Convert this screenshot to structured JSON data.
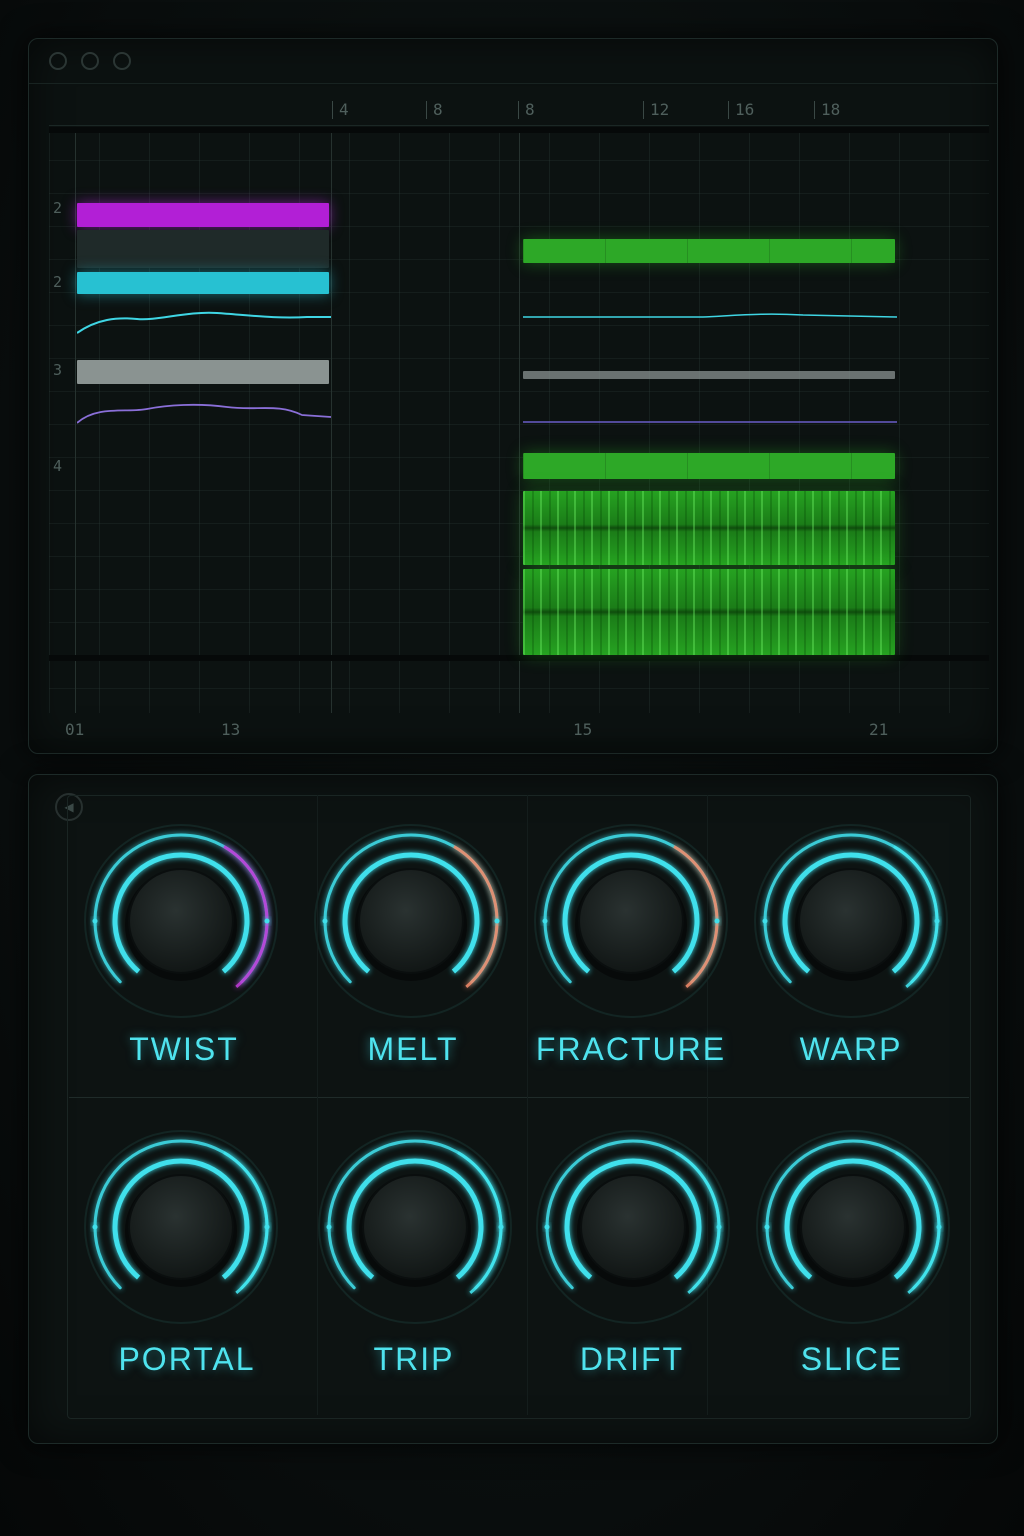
{
  "arrangement": {
    "ruler_top": [
      "4",
      "8",
      "8",
      "12",
      "16",
      "18"
    ],
    "track_numbers": [
      "2",
      "2",
      "3",
      "4"
    ],
    "ruler_bottom": [
      "01",
      "13",
      "15",
      "21"
    ]
  },
  "effects": {
    "knobs": [
      {
        "label": "TWIST",
        "value": 0.5,
        "accent": "#c03ad8"
      },
      {
        "label": "MELT",
        "value": 0.5,
        "accent": "#f08a6a"
      },
      {
        "label": "FRACTURE",
        "value": 0.5,
        "accent": "#f08a6a"
      },
      {
        "label": "WARP",
        "value": 0.5,
        "accent": "#42e6f0"
      },
      {
        "label": "PORTAL",
        "value": 0.5,
        "accent": "#42e6f0"
      },
      {
        "label": "TRIP",
        "value": 0.5,
        "accent": "#42e6f0"
      },
      {
        "label": "DRIFT",
        "value": 0.5,
        "accent": "#42e6f0"
      },
      {
        "label": "SLICE",
        "value": 0.5,
        "accent": "#42e6f0"
      }
    ]
  },
  "colors": {
    "knob_glow": "#3fe0ec",
    "clip_purple": "#b21fd6",
    "clip_cyan": "#27c1d2",
    "clip_green": "#2da827"
  }
}
